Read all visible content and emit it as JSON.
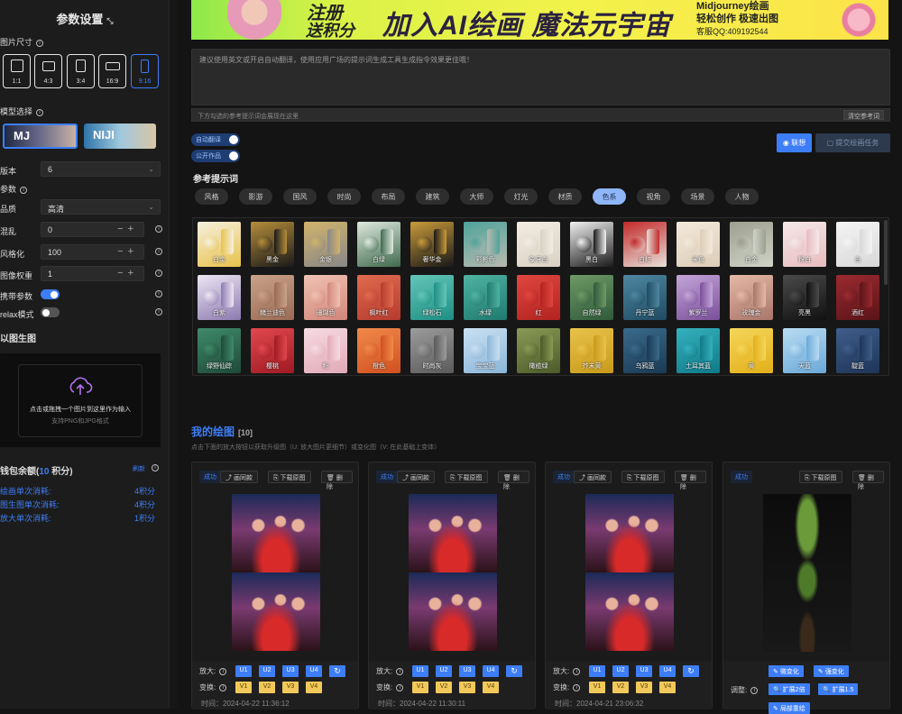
{
  "sidebar": {
    "title": "参数设置",
    "size_label": "图片尺寸",
    "ratios": [
      "1:1",
      "4:3",
      "3:4",
      "16:9",
      "9:16"
    ],
    "selected_ratio": "9:16",
    "model_label": "模型选择",
    "models": [
      "MJ",
      "NIJI"
    ],
    "version": {
      "label": "版本",
      "value": "6"
    },
    "params_label": "参数",
    "quality": {
      "label": "品质",
      "value": "高清"
    },
    "chaos": {
      "label": "混乱",
      "value": "0"
    },
    "stylize": {
      "label": "风格化",
      "value": "100"
    },
    "image_weight": {
      "label": "图像权重",
      "value": "1"
    },
    "carry_params": {
      "label": "携带参数",
      "on": true
    },
    "relax": {
      "label": "relax模式",
      "on": false
    },
    "img2img_title": "以图生图",
    "upload_text": "点击或拖拽一个图片到这里作为输入",
    "upload_sub": "支持PNG和JPG格式",
    "wallet": {
      "prefix": "钱包余额(",
      "value": "10",
      "suffix": " 积分)",
      "refresh": "刷新"
    },
    "costs": [
      {
        "label": "绘画单次消耗:",
        "value": "4积分"
      },
      {
        "label": "图生图单次消耗:",
        "value": "4积分"
      },
      {
        "label": "放大单次消耗:",
        "value": "1积分"
      }
    ]
  },
  "banner": {
    "line1": "注册",
    "line2": "送积分",
    "headline": "加入AI绘画 魔法元宇宙",
    "mj_title": "Midjourney绘画",
    "mj_sub": "轻松创作 极速出图",
    "service": "客服QQ:409192544"
  },
  "prompt": {
    "placeholder": "建议使用英文或开启自动翻译，使用应用广场的提示词生成工具生成指令效果更佳哦！",
    "ref_placeholder": "下方勾选的参考提示词会展现在这里",
    "clear_ref": "清空参考词"
  },
  "switches": {
    "auto_translate": "自动翻译",
    "public": "公开作品"
  },
  "buttons": {
    "associate": "联想",
    "submit": "提交绘画任务"
  },
  "ref_title": "参考提示词",
  "tags": [
    "风格",
    "影游",
    "国风",
    "时尚",
    "布局",
    "建筑",
    "大师",
    "灯光",
    "材质",
    "色系",
    "视角",
    "场景",
    "人物"
  ],
  "active_tag": "色系",
  "swatches": [
    {
      "label": "白金",
      "c1": "#e8c24a",
      "c2": "#f6f0e0"
    },
    {
      "label": "黑金",
      "c1": "#1a1a1a",
      "c2": "#b58d3a"
    },
    {
      "label": "金银",
      "c1": "#888888",
      "c2": "#d1b36b"
    },
    {
      "label": "白绿",
      "c1": "#3f6a4e",
      "c2": "#dfe9df"
    },
    {
      "label": "奢华金",
      "c1": "#191919",
      "c2": "#c99a3a"
    },
    {
      "label": "彩影色",
      "c1": "#b9b9b0",
      "c2": "#4ea39a"
    },
    {
      "label": "象牙白",
      "c1": "#d9d2c4",
      "c2": "#f2ece2"
    },
    {
      "label": "黑白",
      "c1": "#1b1b1b",
      "c2": "#f0f0f0"
    },
    {
      "label": "白红",
      "c1": "#e7e0da",
      "c2": "#c22a2a"
    },
    {
      "label": "米色",
      "c1": "#dccdb7",
      "c2": "#f3e9dc"
    },
    {
      "label": "白金",
      "c1": "#cfd3c8",
      "c2": "#9da08f"
    },
    {
      "label": "粉白",
      "c1": "#e7bcc0",
      "c2": "#f5e8e8"
    },
    {
      "label": "白",
      "c1": "#d8d8d8",
      "c2": "#f4f4f4"
    },
    {
      "label": "白紫",
      "c1": "#8c7ab0",
      "c2": "#ece6f3"
    },
    {
      "label": "赭兰迪色",
      "c1": "#9a6a55",
      "c2": "#c9a288"
    },
    {
      "label": "珊瑚色",
      "c1": "#d1877a",
      "c2": "#f0c1b3"
    },
    {
      "label": "枫叶红",
      "c1": "#b63a2e",
      "c2": "#e06b4f"
    },
    {
      "label": "绿松石",
      "c1": "#1e8f84",
      "c2": "#64c5b8"
    },
    {
      "label": "水绿",
      "c1": "#1f7a6e",
      "c2": "#4fb3a2"
    },
    {
      "label": "红",
      "c1": "#b2231f",
      "c2": "#e04640"
    },
    {
      "label": "自然绿",
      "c1": "#2f5a3a",
      "c2": "#6e9a66"
    },
    {
      "label": "丹宁蓝",
      "c1": "#1f4b63",
      "c2": "#4f87a1"
    },
    {
      "label": "紫罗兰",
      "c1": "#7a4f9a",
      "c2": "#c4a5d8"
    },
    {
      "label": "玫瑰金",
      "c1": "#a8766a",
      "c2": "#e5b8a6"
    },
    {
      "label": "亮黑",
      "c1": "#111111",
      "c2": "#4a4a4a"
    },
    {
      "label": "酒红",
      "c1": "#5a1418",
      "c2": "#9a2a30"
    },
    {
      "label": "绿野仙踪",
      "c1": "#1f4a3a",
      "c2": "#3f8a6a"
    },
    {
      "label": "樱桃",
      "c1": "#a01a22",
      "c2": "#e0484e"
    },
    {
      "label": "粉",
      "c1": "#e2a9b8",
      "c2": "#f6dbe2"
    },
    {
      "label": "橙色",
      "c1": "#d05020",
      "c2": "#f08a4a"
    },
    {
      "label": "时尚灰",
      "c1": "#5a5a5a",
      "c2": "#9c9c9c"
    },
    {
      "label": "宝宝蓝",
      "c1": "#8ab5d8",
      "c2": "#c9e0f2"
    },
    {
      "label": "橄榄绿",
      "c1": "#4d5a2a",
      "c2": "#8a9a55"
    },
    {
      "label": "芥末黄",
      "c1": "#c89a1a",
      "c2": "#e8c24a"
    },
    {
      "label": "乌鸦蓝",
      "c1": "#1a3a55",
      "c2": "#3a6a8a"
    },
    {
      "label": "土耳其蓝",
      "c1": "#107a88",
      "c2": "#35b0bd"
    },
    {
      "label": "黄",
      "c1": "#e2b01a",
      "c2": "#f5d55a"
    },
    {
      "label": "天蓝",
      "c1": "#6aa8d8",
      "c2": "#b8dcf2"
    },
    {
      "label": "靛蓝",
      "c1": "#1f3458",
      "c2": "#3f5e8a"
    }
  ],
  "my_drawings": {
    "title": "我的绘图",
    "count": "[10]",
    "subtitle": "点击下面的放大按钮以获取升级图（U: 放大图片更细节）或变化图（V: 在此基础上变体）"
  },
  "cards": [
    {
      "status": "成功",
      "btn1": "画同款",
      "btn2": "下载原图",
      "btn3": "删除",
      "upscale": "放大:",
      "variation": "变换:",
      "time": "时间：2024-04-22 11:36:12"
    },
    {
      "status": "成功",
      "btn1": "画同款",
      "btn2": "下载原图",
      "btn3": "删除",
      "upscale": "放大:",
      "variation": "变换:",
      "time": "时间：2024-04-22 11:30:11"
    },
    {
      "status": "成功",
      "btn1": "画同款",
      "btn2": "下载原图",
      "btn3": "删除",
      "upscale": "放大:",
      "variation": "变换:",
      "time": "时间：2024-04-21 23:06:32"
    },
    {
      "status": "成功",
      "btn2": "下载原图",
      "btn3": "删除",
      "adjust": "调整:",
      "tools": [
        "微变化",
        "强变化",
        "扩展2倍",
        "扩展1.5",
        "局部重绘"
      ]
    }
  ],
  "u_labels": [
    "U1",
    "U2",
    "U3",
    "U4"
  ],
  "v_labels": [
    "V1",
    "V2",
    "V3",
    "V4"
  ]
}
